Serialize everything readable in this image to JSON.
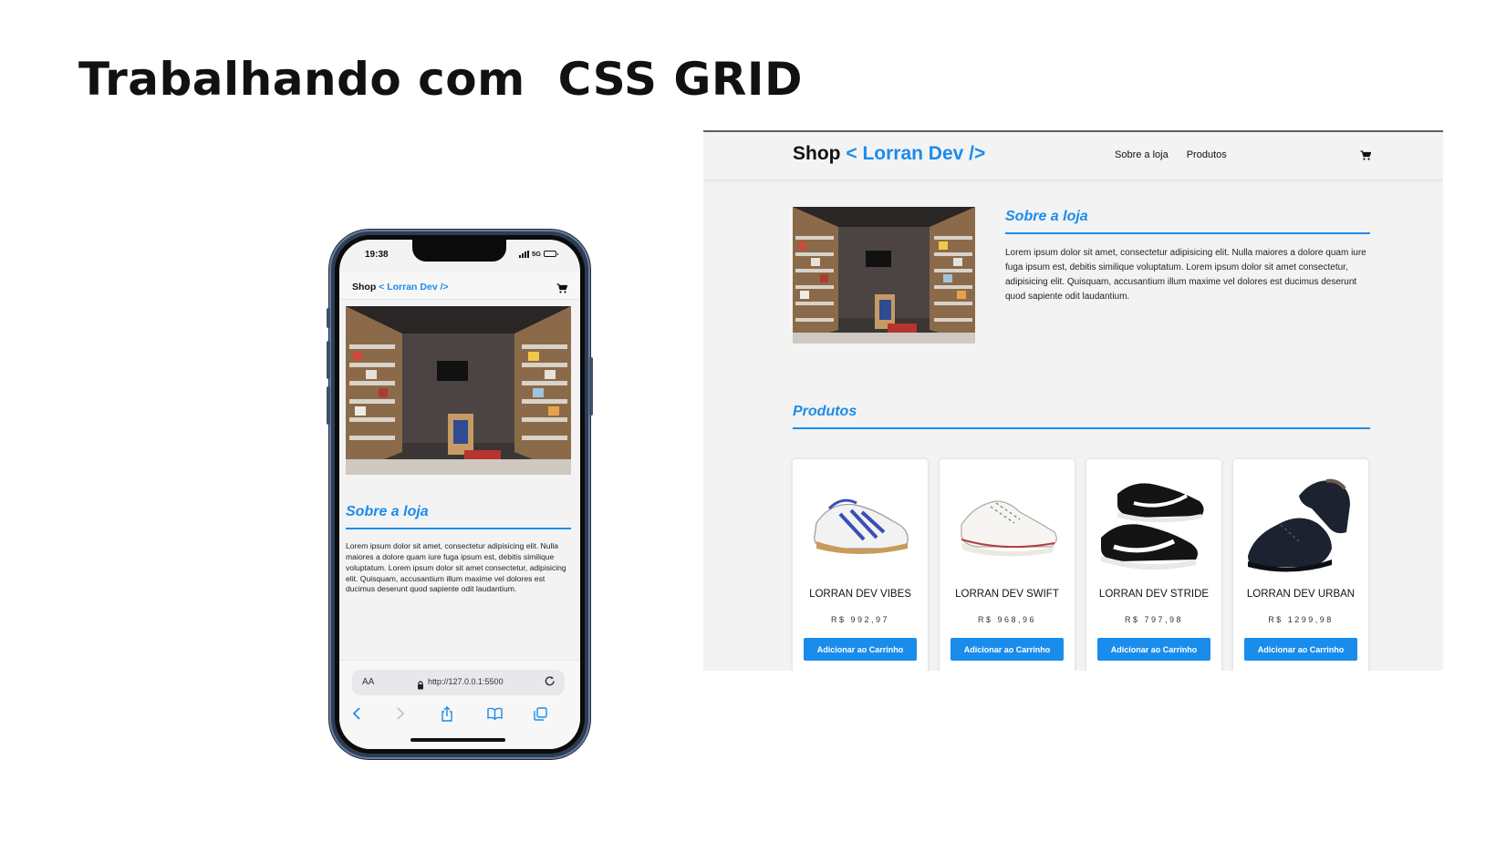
{
  "slide": {
    "title": "Trabalhando com  CSS GRID"
  },
  "mobile": {
    "status_time": "19:38",
    "network": "5G",
    "logo_shop": "Shop",
    "logo_dev": "< Lorran Dev />",
    "about_title": "Sobre a loja",
    "about_text": "Lorem ipsum dolor sit amet, consectetur adipisicing elit. Nulla maiores a dolore quam iure fuga ipsum est, debitis similique voluptatum. Lorem ipsum dolor sit amet consectetur, adipisicing elit. Quisquam, accusantium illum maxime vel dolores est ducimus deserunt quod sapiente odit laudantium.",
    "url_aa": "AA",
    "url": "http://127.0.0.1:5500",
    "icons": [
      "cart-icon",
      "lock-icon",
      "reload-icon",
      "back-icon",
      "forward-icon",
      "share-icon",
      "bookmarks-icon",
      "tabs-icon"
    ]
  },
  "desktop": {
    "logo_shop": "Shop",
    "logo_dev": "< Lorran Dev />",
    "nav": [
      "Sobre a loja",
      "Produtos"
    ],
    "about_title": "Sobre a loja",
    "about_text": "Lorem ipsum dolor sit amet, consectetur adipisicing elit. Nulla maiores a dolore quam iure fuga ipsum est, debitis similique voluptatum. Lorem ipsum dolor sit amet consectetur, adipisicing elit. Quisquam, accusantium illum maxime vel dolores est ducimus deserunt quod sapiente odit laudantium.",
    "products_title": "Produtos",
    "products": [
      {
        "name": "LORRAN DEV VIBES",
        "price": "R$ 992,97",
        "button": "Adicionar ao Carrinho"
      },
      {
        "name": "LORRAN DEV SWIFT",
        "price": "R$ 968,96",
        "button": "Adicionar ao Carrinho"
      },
      {
        "name": "LORRAN DEV STRIDE",
        "price": "R$ 797,98",
        "button": "Adicionar ao Carrinho"
      },
      {
        "name": "LORRAN DEV URBAN",
        "price": "R$ 1299,98",
        "button": "Adicionar ao Carrinho"
      }
    ]
  },
  "colors": {
    "accent": "#1a8cec",
    "background": "#f3f3f3",
    "card": "#ffffff"
  }
}
